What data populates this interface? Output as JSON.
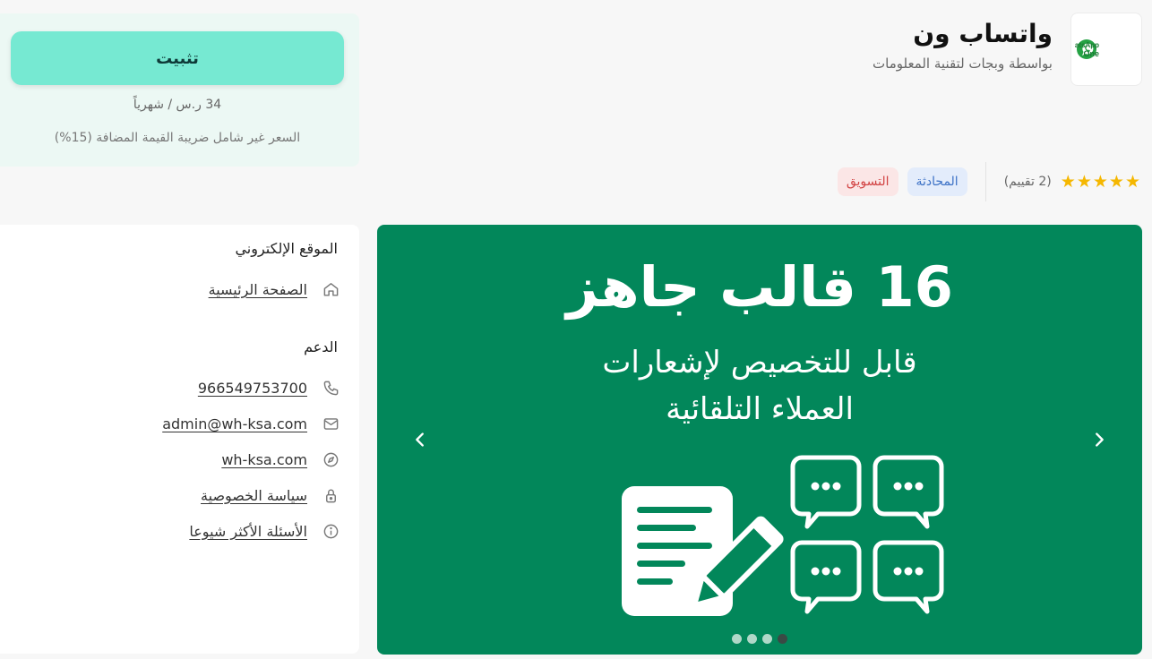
{
  "app": {
    "name": "واتساب ون",
    "vendor": "بواسطة وبجات لتقنية المعلومات",
    "logo_text_line1": "WhatsApp",
    "logo_text_line2": "One"
  },
  "rating": {
    "stars": 5,
    "count_label": "(2 تقييم)"
  },
  "tags": [
    {
      "label": "المحادثة",
      "color": "#3d72c6"
    },
    {
      "label": "التسويق",
      "color": "#d24343"
    }
  ],
  "install": {
    "button_label": "تثبيت",
    "price": "34 ر.س / شهرياً",
    "vat_note": "السعر غير شامل ضريبة القيمة المضافة (15%)"
  },
  "website": {
    "title": "الموقع الإلكتروني",
    "home_link": "الصفحة الرئيسية"
  },
  "support": {
    "title": "الدعم",
    "phone": "966549753700",
    "email": "admin@wh-ksa.com",
    "site": "wh-ksa.com",
    "privacy": "سياسة الخصوصية",
    "faq": "الأسئلة الأكثر شيوعا"
  },
  "carousel": {
    "title": "16 قالب جاهز",
    "subtitle_line1": "قابل للتخصيص لإشعارات",
    "subtitle_line2": "العملاء التلقائية",
    "slide_count": 4,
    "active_slide": 4,
    "background": "#02875a"
  },
  "colors": {
    "install_button": "#76e9d2",
    "star": "#f5b700"
  }
}
